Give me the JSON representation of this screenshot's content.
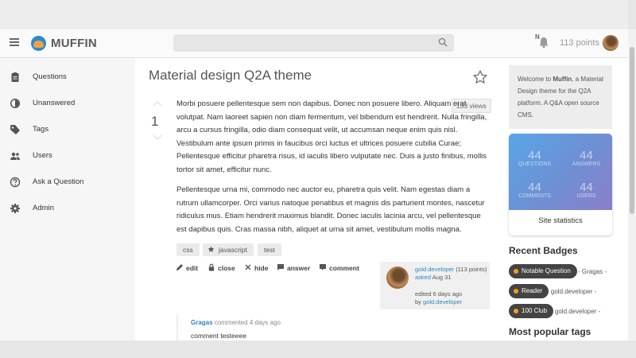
{
  "header": {
    "logo_text": "MUFFIN",
    "notification_letter": "N",
    "points": "113 points"
  },
  "sidebar": {
    "items": [
      {
        "label": "Questions"
      },
      {
        "label": "Unanswered"
      },
      {
        "label": "Tags"
      },
      {
        "label": "Users"
      },
      {
        "label": "Ask a Question"
      },
      {
        "label": "Admin"
      }
    ]
  },
  "question": {
    "title": "Material design Q2A theme",
    "votes": "1",
    "views": "133 views",
    "paragraph1": "Morbi posuere pellentesque sem non dapibus. Donec non posuere libero. Aliquam erat volutpat. Nam laoreet sapien non diam fermentum, vel bibendum est hendrerit. Nulla fringilla, arcu a cursus fringilla, odio diam consequat velit, ut accumsan neque enim quis nisl. Vestibulum ante ipsum primis in faucibus orci luctus et ultrices posuere cubilia Curae; Pellentesque efficitur pharetra risus, id iaculis libero vulputate nec. Duis a justo finibus, mollis tortor sit amet, efficitur nunc.",
    "paragraph2": "Pellentesque urna mi, commodo nec auctor eu, pharetra quis velit. Nam egestas diam a rutrum ullamcorper. Orci varius natoque penatibus et magnis dis parturient montes, nascetur ridiculus mus. Etiam hendrerit maximus blandit. Donec iaculis lacinia arcu, vel pellentesque est dapibus quis. Cras massa nibh, aliquet at urna sit amet, vestibulum mollis magna.",
    "tags": [
      "css",
      "javascript",
      "test"
    ],
    "actions": {
      "edit": "edit",
      "close": "close",
      "hide": "hide",
      "answer": "answer",
      "comment": "comment"
    },
    "meta": {
      "author": "gold.developer",
      "author_points": "(113 points)",
      "asked": "asked",
      "asked_date": "Aug 31",
      "edited": "edited 6 days ago",
      "edited_by_prefix": "by",
      "edited_by": "gold.developer"
    }
  },
  "comment": {
    "author": "Gragas",
    "when": "commented 4 days ago",
    "text": "comment testeeee"
  },
  "right": {
    "welcome_prefix": "Welcome to ",
    "welcome_brand": "Muffin",
    "welcome_suffix": ", a Material Design theme for the Q2A platform. A Q&A open source CMS.",
    "stats": [
      {
        "value": "44",
        "label": "QUESTIONS"
      },
      {
        "value": "44",
        "label": "ANSWERS"
      },
      {
        "value": "44",
        "label": "COMMENTS"
      },
      {
        "value": "44",
        "label": "USERS"
      }
    ],
    "stats_label": "Site statistics",
    "recent_badges_title": "Recent Badges",
    "badges": [
      {
        "name": "Notable Question",
        "user": "- Gragas -"
      },
      {
        "name": "Reader",
        "user": "- gold.developer -"
      },
      {
        "name": "100 Club",
        "user": "- gold.developer -"
      }
    ],
    "popular_tags_title": "Most popular tags"
  },
  "colors": {
    "link": "#2e86c1",
    "badge_bg": "#444444",
    "badge_dot": "#f0a020"
  }
}
